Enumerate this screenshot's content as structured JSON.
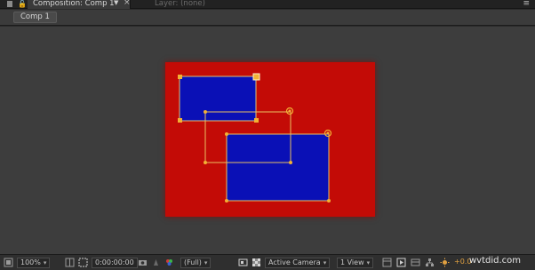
{
  "panel": {
    "composition_tab": "Composition: Comp 1",
    "layer_tab": "Layer: (none)",
    "menu_icon": "panel-menu-icon"
  },
  "breadcrumb": {
    "comp": "Comp 1"
  },
  "stage": {
    "background_color": "#c30b06",
    "layer_color": "#0a10b6",
    "handle_color": "#f2b134"
  },
  "toolbar": {
    "zoom": "100%",
    "timecode": "0:00:00:00",
    "resolution": "(Full)",
    "camera": "Active Camera",
    "view": "1 View",
    "exposure": "+0.0"
  },
  "watermark": "wvtdid.com"
}
